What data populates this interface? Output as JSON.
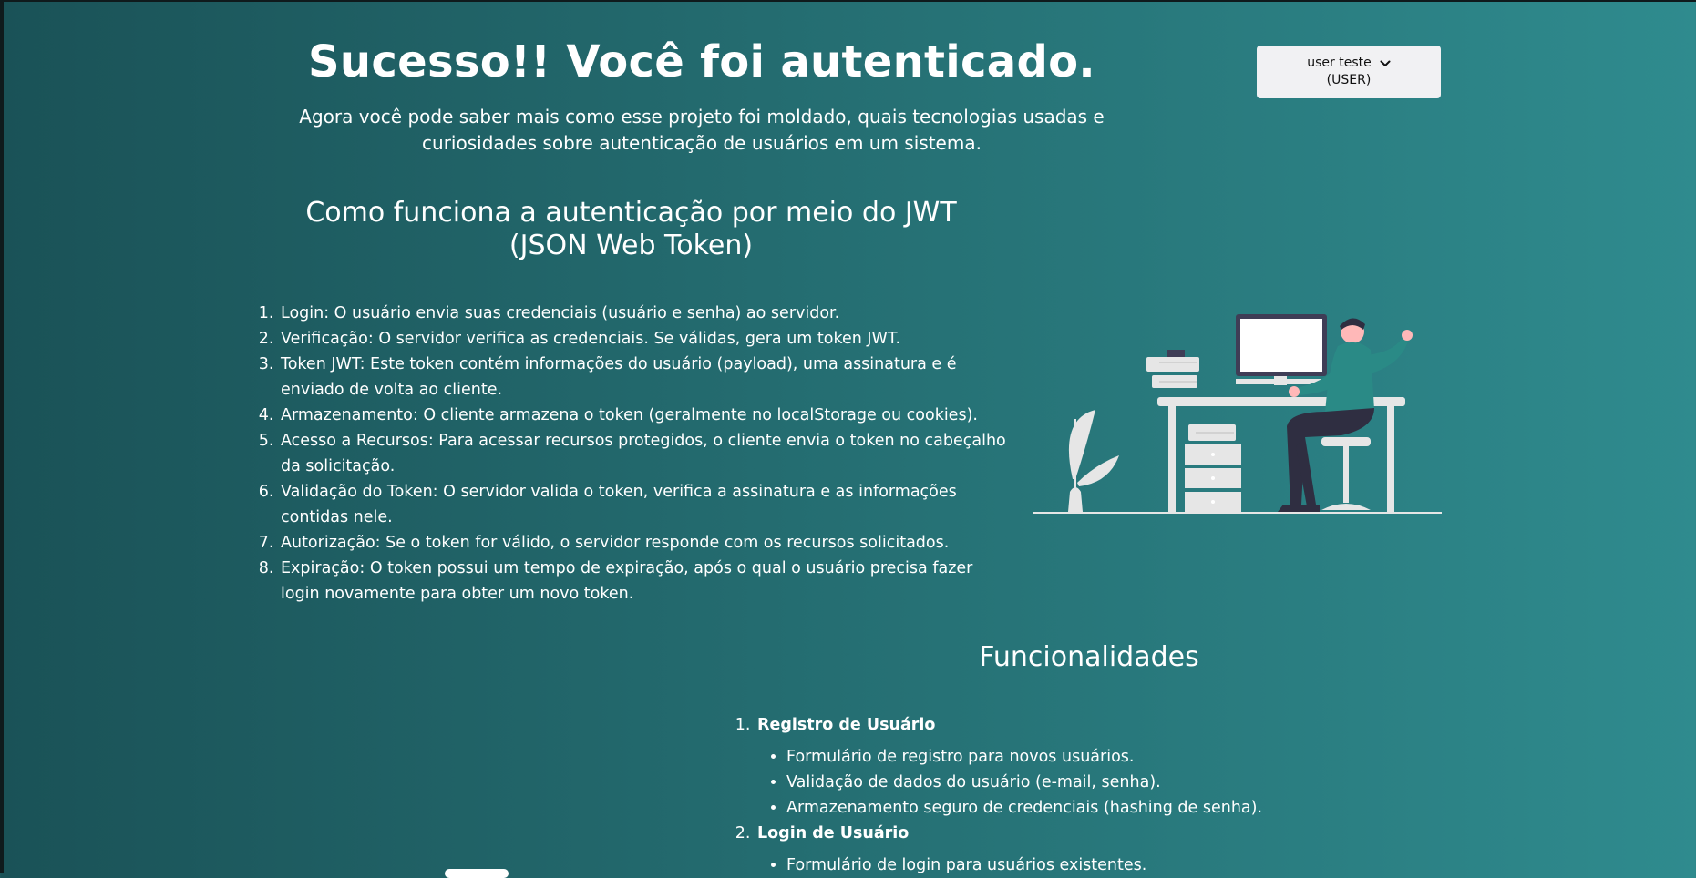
{
  "header": {
    "title": "Sucesso!! Você foi autenticado.",
    "subtitle": "Agora você pode saber mais como esse projeto foi moldado, quais tecnologias usadas e curiosidades sobre autenticação de usuários em um sistema."
  },
  "user_menu": {
    "name": "user teste",
    "role": "(USER)",
    "icon": "chevron-down-icon"
  },
  "jwt_section": {
    "title": "Como funciona a autenticação por meio do JWT (JSON Web Token)",
    "steps": [
      "Login: O usuário envia suas credenciais (usuário e senha) ao servidor.",
      "Verificação: O servidor verifica as credenciais. Se válidas, gera um token JWT.",
      "Token JWT: Este token contém informações do usuário (payload), uma assinatura e é enviado de volta ao cliente.",
      "Armazenamento: O cliente armazena o token (geralmente no localStorage ou cookies).",
      "Acesso a Recursos: Para acessar recursos protegidos, o cliente envia o token no cabeçalho da solicitação.",
      "Validação do Token: O servidor valida o token, verifica a assinatura e as informações contidas nele.",
      "Autorização: Se o token for válido, o servidor responde com os recursos solicitados.",
      "Expiração: O token possui um tempo de expiração, após o qual o usuário precisa fazer login novamente para obter um novo token."
    ]
  },
  "features_section": {
    "title": "Funcionalidades",
    "items": [
      {
        "title": "Registro de Usuário",
        "points": [
          "Formulário de registro para novos usuários.",
          "Validação de dados do usuário (e-mail, senha).",
          "Armazenamento seguro de credenciais (hashing de senha)."
        ]
      },
      {
        "title": "Login de Usuário",
        "points": [
          "Formulário de login para usuários existentes."
        ]
      }
    ]
  },
  "colors": {
    "background_start": "#1a5257",
    "background_end": "#2f8b8e",
    "text": "#ffffff",
    "user_menu_bg": "#f1f1f3",
    "illustration_accent": "#2a8a86"
  }
}
